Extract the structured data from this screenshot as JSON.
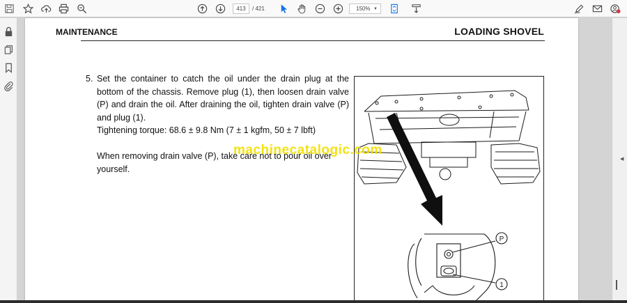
{
  "toolbar": {
    "page_current": "413",
    "page_total": "/ 421",
    "zoom": "150%"
  },
  "document": {
    "header_left": "MAINTENANCE",
    "header_right": "LOADING SHOVEL",
    "step_number": "5.",
    "step_text": "Set the container to catch the oil under the drain plug at the bottom of the chassis. Remove plug (1), then loosen drain valve (P) and drain the oil. After draining the oil, tighten drain valve (P) and plug (1).",
    "torque": "Tightening torque: 68.6 ± 9.8 Nm (7 ± 1 kgfm, 50 ± 7 lbft)",
    "note": "When removing drain valve (P), take care not to pour oil over yourself.",
    "callout_p": "P",
    "callout_1": "1",
    "watermark": "machinecatalogic.com"
  },
  "colors": {
    "watermark": "#f2e000",
    "toolbar_bg": "#f9f9f9",
    "viewer_bg": "#d4d4d4"
  }
}
